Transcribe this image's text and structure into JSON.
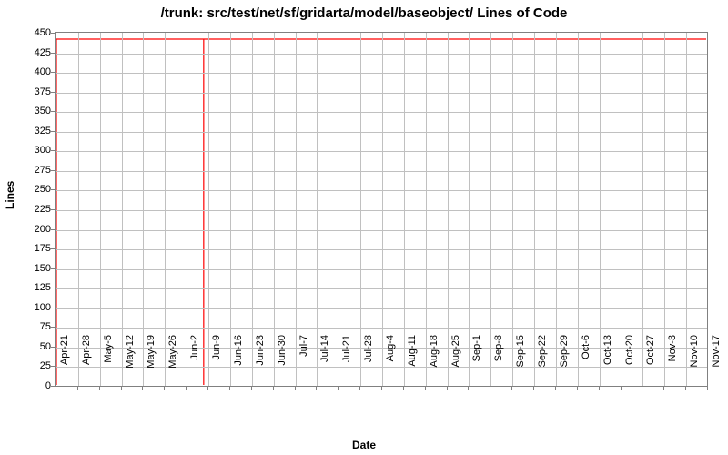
{
  "chart_data": {
    "type": "line",
    "title": "/trunk: src/test/net/sf/gridarta/model/baseobject/ Lines of Code",
    "xlabel": "Date",
    "ylabel": "Lines",
    "ylim": [
      0,
      450
    ],
    "y_ticks": [
      0,
      25,
      50,
      75,
      100,
      125,
      150,
      175,
      200,
      225,
      250,
      275,
      300,
      325,
      350,
      375,
      400,
      425,
      450
    ],
    "categories": [
      "21-Apr",
      "28-Apr",
      "5-May",
      "12-May",
      "19-May",
      "26-May",
      "2-Jun",
      "9-Jun",
      "16-Jun",
      "23-Jun",
      "30-Jun",
      "7-Jul",
      "14-Jul",
      "21-Jul",
      "28-Jul",
      "4-Aug",
      "11-Aug",
      "18-Aug",
      "25-Aug",
      "1-Sep",
      "8-Sep",
      "15-Sep",
      "22-Sep",
      "29-Sep",
      "6-Oct",
      "13-Oct",
      "20-Oct",
      "27-Oct",
      "3-Nov",
      "10-Nov",
      "17-Nov"
    ],
    "series": [
      {
        "name": "Lines of Code",
        "color": "#ff0000",
        "points": [
          {
            "x_index": 0.0,
            "y": 0
          },
          {
            "x_index": 0.0,
            "y": 443
          },
          {
            "x_index": 6.8,
            "y": 443
          },
          {
            "x_index": 6.8,
            "y": 0
          },
          {
            "x_index": 6.8,
            "y": 443
          },
          {
            "x_index": 30.0,
            "y": 443
          }
        ]
      }
    ]
  }
}
